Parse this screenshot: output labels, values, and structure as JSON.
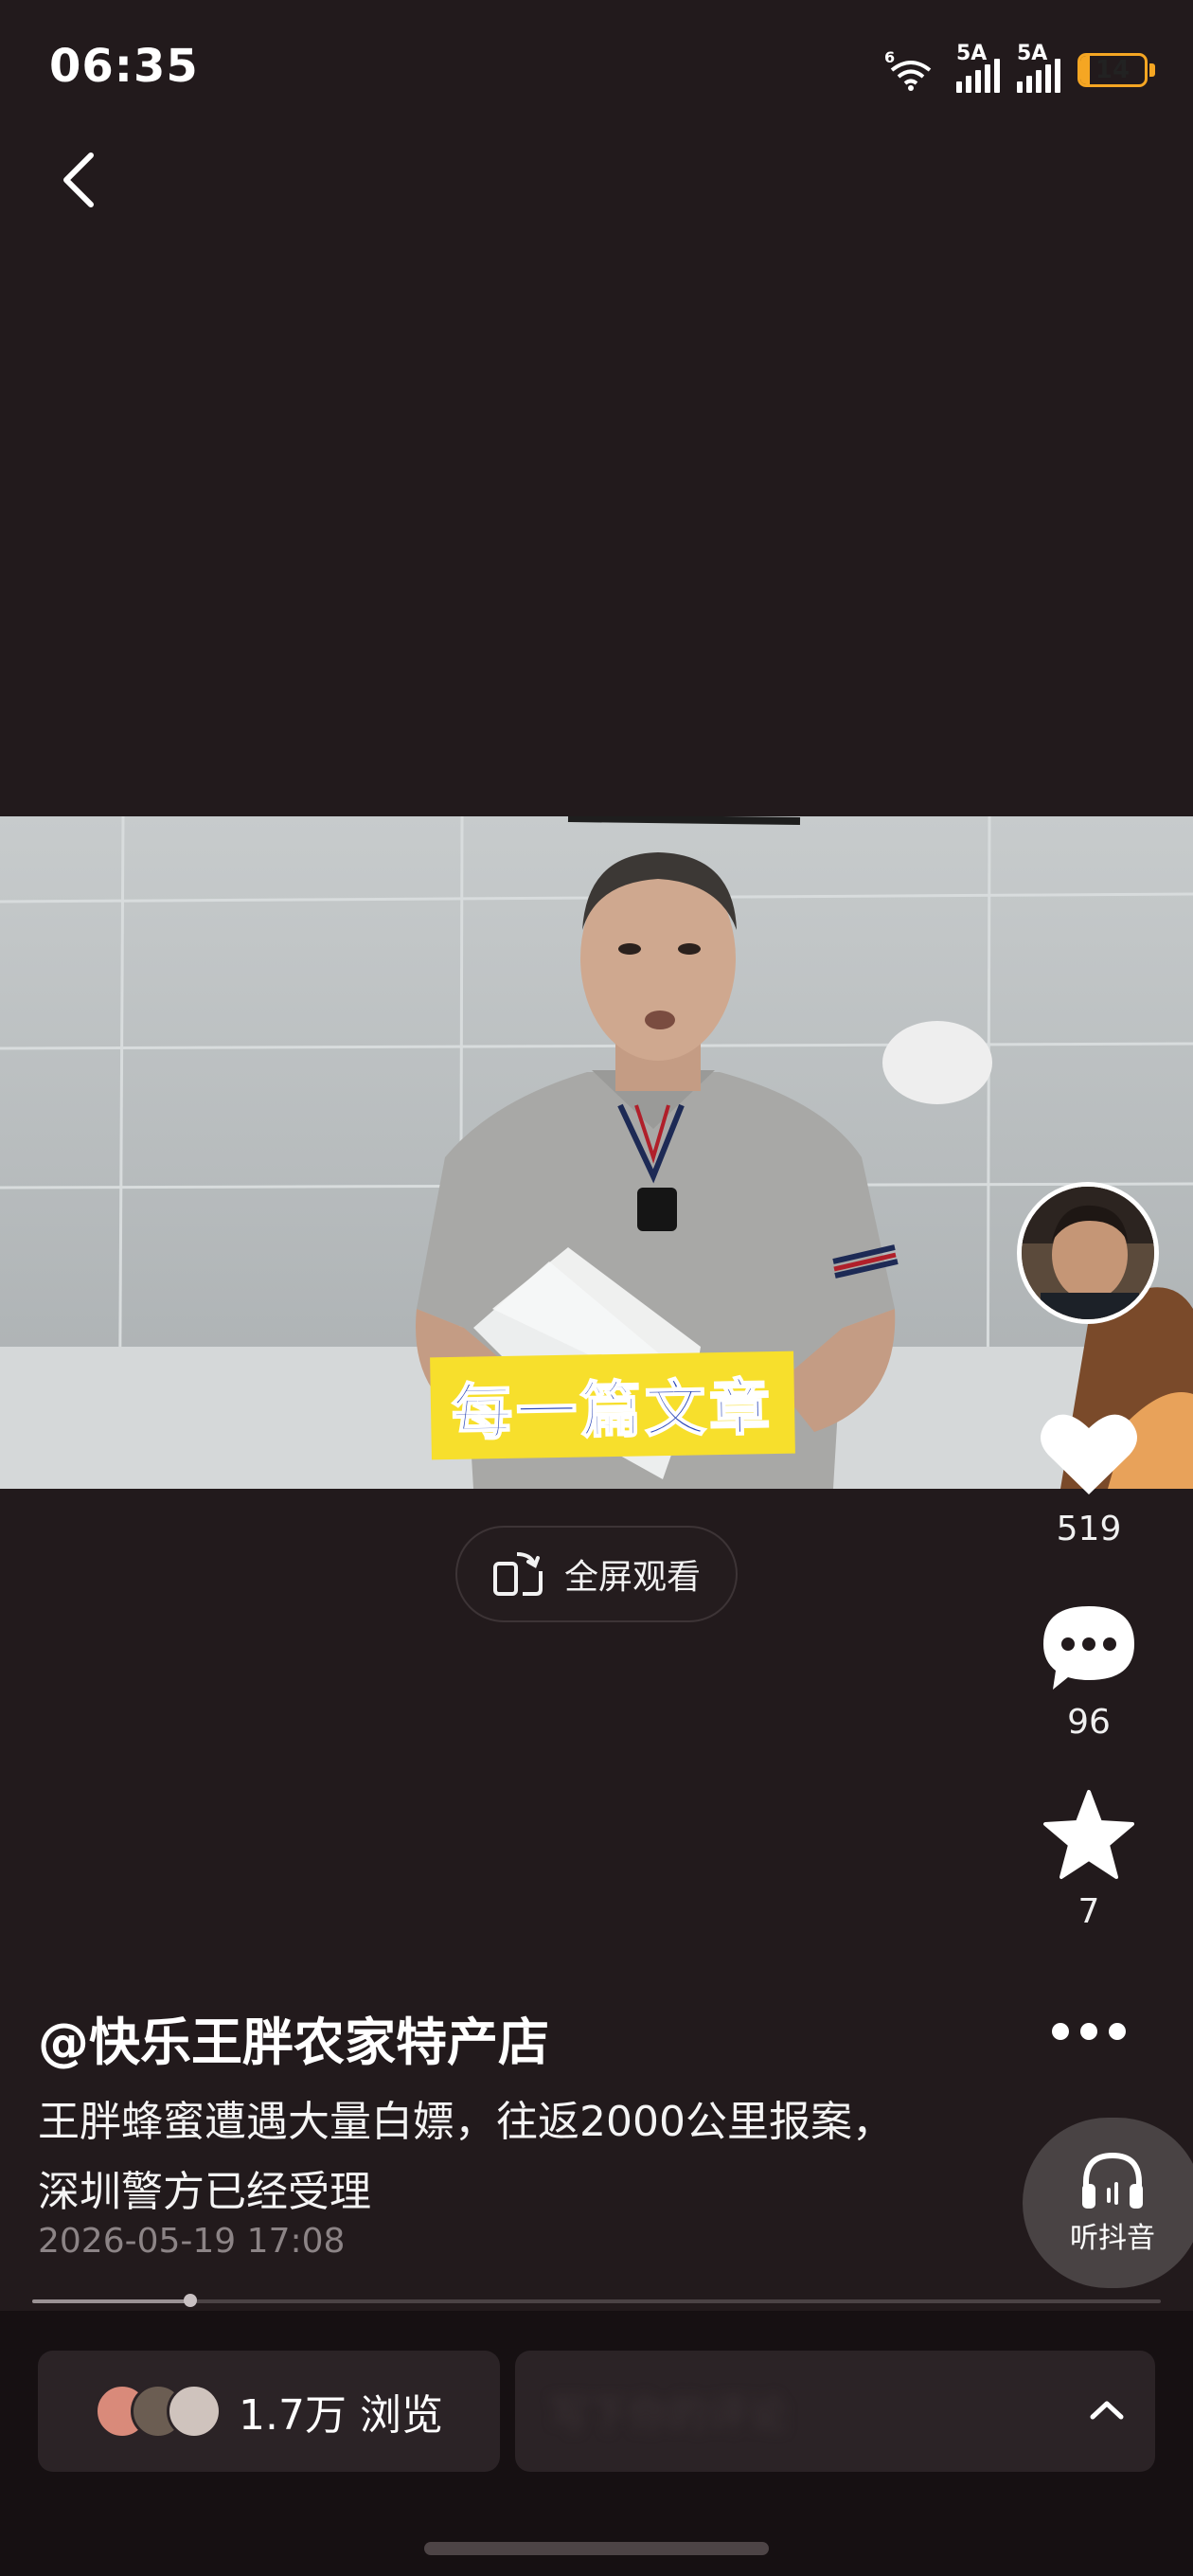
{
  "status_bar": {
    "time": "06:35",
    "network_wifi": "6",
    "signal1_label": "5A",
    "signal2_label": "5A",
    "battery_level": "14",
    "battery_fraction": 0.14,
    "battery_color": "#f5a623"
  },
  "video": {
    "caption_sticker": "每一篇文章",
    "fullscreen_label": "全屏观看"
  },
  "actions": {
    "likes": "519",
    "comments": "96",
    "favorites": "7",
    "listen_label": "听抖音"
  },
  "post": {
    "author": "@快乐王胖农家特产店",
    "description": "王胖蜂蜜遭遇大量白嫖，往返2000公里报案，深圳警方已经受理",
    "time": "2026-05-19 17:08",
    "progress": 0.14
  },
  "bottom": {
    "views": "1.7万 浏览",
    "comment_placeholder": "写下你的评论"
  },
  "icons": [
    "back-icon",
    "wifi-icon",
    "signal-icon",
    "battery-icon",
    "rotate-screen-icon",
    "heart-icon",
    "comment-icon",
    "star-icon",
    "more-icon",
    "headphones-icon",
    "chevron-up-icon"
  ]
}
